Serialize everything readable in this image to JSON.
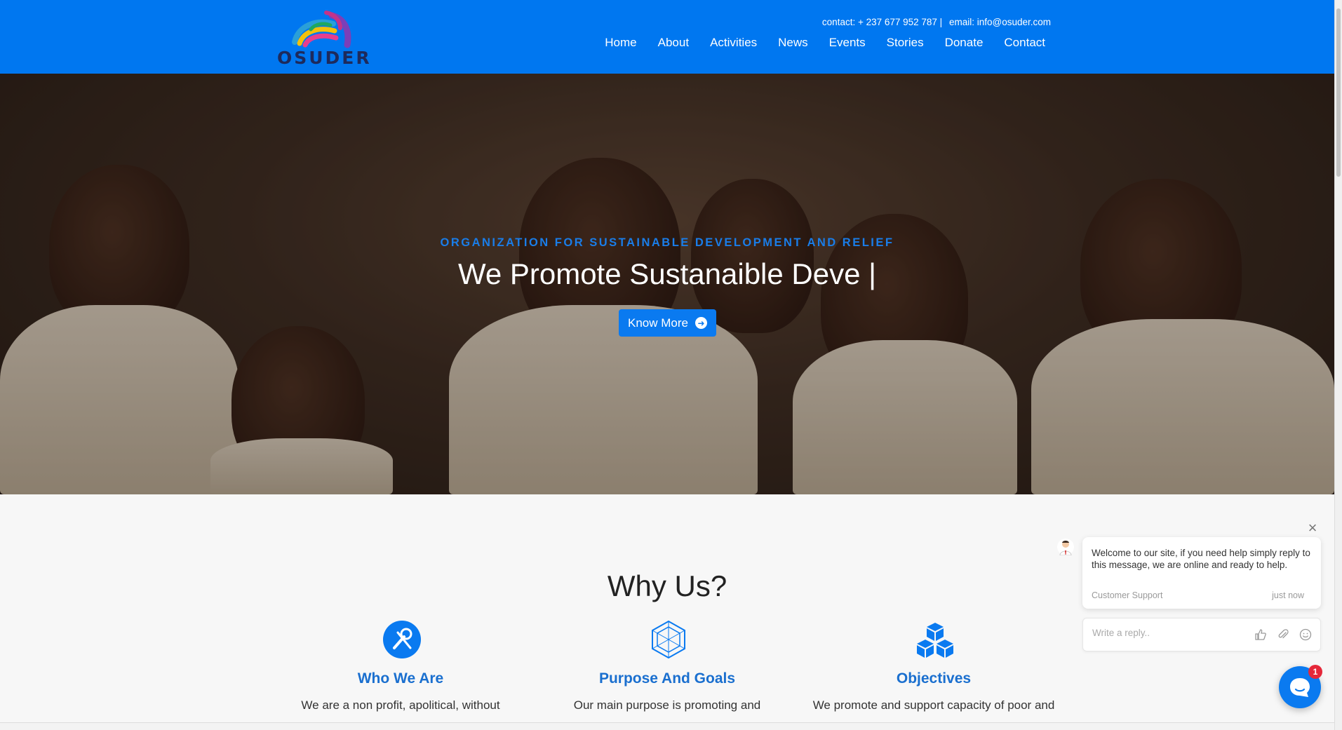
{
  "brand": {
    "name": "OSUDER",
    "logo_icon": "rainbow-swirl-logo"
  },
  "topbar": {
    "contact": "contact: + 237 677 952 787 |",
    "email": "email: info@osuder.com"
  },
  "nav": [
    {
      "label": "Home"
    },
    {
      "label": "About"
    },
    {
      "label": "Activities"
    },
    {
      "label": "News"
    },
    {
      "label": "Events"
    },
    {
      "label": "Stories"
    },
    {
      "label": "Donate"
    },
    {
      "label": "Contact"
    }
  ],
  "hero": {
    "subtitle": "ORGANIZATION FOR SUSTAINABLE DEVELOPMENT AND RELIEF",
    "title": "We Promote Sustanaible Deve |",
    "button_label": "Know More",
    "button_icon": "arrow-circle-right-icon"
  },
  "why": {
    "title": "Why Us?",
    "features": [
      {
        "name": "Who We Are",
        "desc": "We are a non profit, apolitical, without",
        "icon": "tools-icon"
      },
      {
        "name": "Purpose And Goals",
        "desc": "Our main purpose is promoting and",
        "icon": "hexagon-icon"
      },
      {
        "name": "Objectives",
        "desc": "We promote and support capacity of poor and",
        "icon": "cubes-icon"
      }
    ]
  },
  "chat": {
    "message": "Welcome to our site, if you need help simply reply to this message, we are online and ready to help.",
    "author": "Customer Support",
    "time": "just now",
    "placeholder": "Write a reply..",
    "badge": "1"
  },
  "colors": {
    "primary": "#0077f0",
    "accent_text": "#1a6fcf",
    "badge": "#e5283a"
  }
}
